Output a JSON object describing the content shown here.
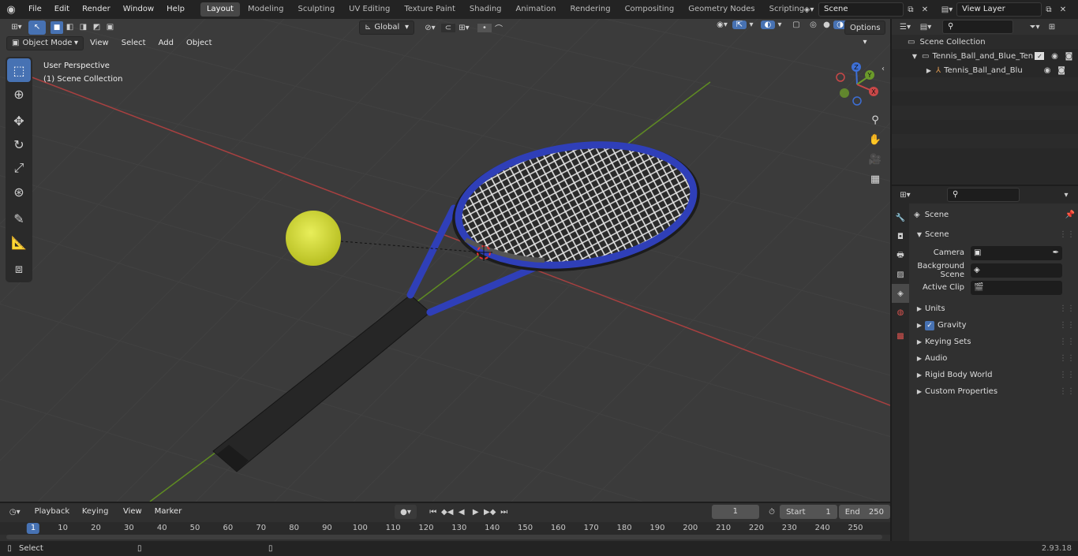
{
  "menus": [
    "File",
    "Edit",
    "Render",
    "Window",
    "Help"
  ],
  "workspaces": [
    "Layout",
    "Modeling",
    "Sculpting",
    "UV Editing",
    "Texture Paint",
    "Shading",
    "Animation",
    "Rendering",
    "Compositing",
    "Geometry Nodes",
    "Scripting"
  ],
  "scene_name": "Scene",
  "view_layer": "View Layer",
  "viewport": {
    "mode": "Object Mode",
    "menu": [
      "View",
      "Select",
      "Add",
      "Object"
    ],
    "orientation": "Global",
    "options": "Options",
    "info_line1": "User Perspective",
    "info_line2": "(1) Scene Collection"
  },
  "gizmo": {
    "z": "Z",
    "y": "Y",
    "x": "X"
  },
  "timeline": {
    "menu": [
      "Playback",
      "Keying",
      "View",
      "Marker"
    ],
    "current_frame": "1",
    "start_label": "Start",
    "start": "1",
    "end_label": "End",
    "end": "250",
    "ticks": [
      "1",
      "10",
      "20",
      "30",
      "40",
      "50",
      "60",
      "70",
      "80",
      "90",
      "100",
      "110",
      "120",
      "130",
      "140",
      "150",
      "160",
      "170",
      "180",
      "190",
      "200",
      "210",
      "220",
      "230",
      "240",
      "250"
    ]
  },
  "outliner": {
    "root": "Scene Collection",
    "item1": "Tennis_Ball_and_Blue_Tennis_",
    "item2": "Tennis_Ball_and_Blue_Te"
  },
  "properties": {
    "context": "Scene",
    "panel": "Scene",
    "camera_label": "Camera",
    "background_label": "Background Scene",
    "clip_label": "Active Clip",
    "sections": [
      "Units",
      "Gravity",
      "Keying Sets",
      "Audio",
      "Rigid Body World",
      "Custom Properties"
    ]
  },
  "status": {
    "left": "Select",
    "version": "2.93.18"
  },
  "colors": {
    "accent": "#4772b3",
    "racket_blue": "#2f3fb8",
    "ball": "#d9df3a",
    "x_axis": "#c94848",
    "y_axis": "#6b9a2a"
  }
}
